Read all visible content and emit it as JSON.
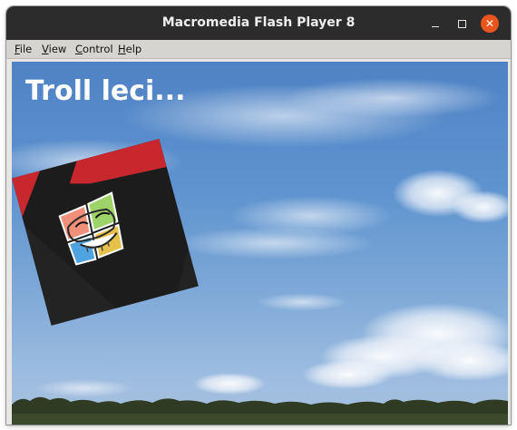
{
  "window": {
    "title": "Macromedia Flash Player 8"
  },
  "menu": {
    "items": [
      {
        "label": "File",
        "mnemonic": "F",
        "rest": "ile"
      },
      {
        "label": "View",
        "mnemonic": "V",
        "rest": "iew"
      },
      {
        "label": "Control",
        "mnemonic": "C",
        "rest": "ontrol"
      },
      {
        "label": "Help",
        "mnemonic": "H",
        "rest": "elp"
      }
    ]
  },
  "stage": {
    "text": "Troll leci...",
    "background": "sky-with-clouds-and-treeline",
    "sprite": "rotated-dark-square-with-troll-face-windows-logo"
  },
  "colors": {
    "titlebar": "#2c2c2c",
    "close_button": "#e9541f",
    "sprite_red": "#c8282d",
    "sprite_dark": "#232323"
  },
  "icons": {
    "minimize": "minimize-icon",
    "maximize": "maximize-icon",
    "close": "close-icon"
  }
}
